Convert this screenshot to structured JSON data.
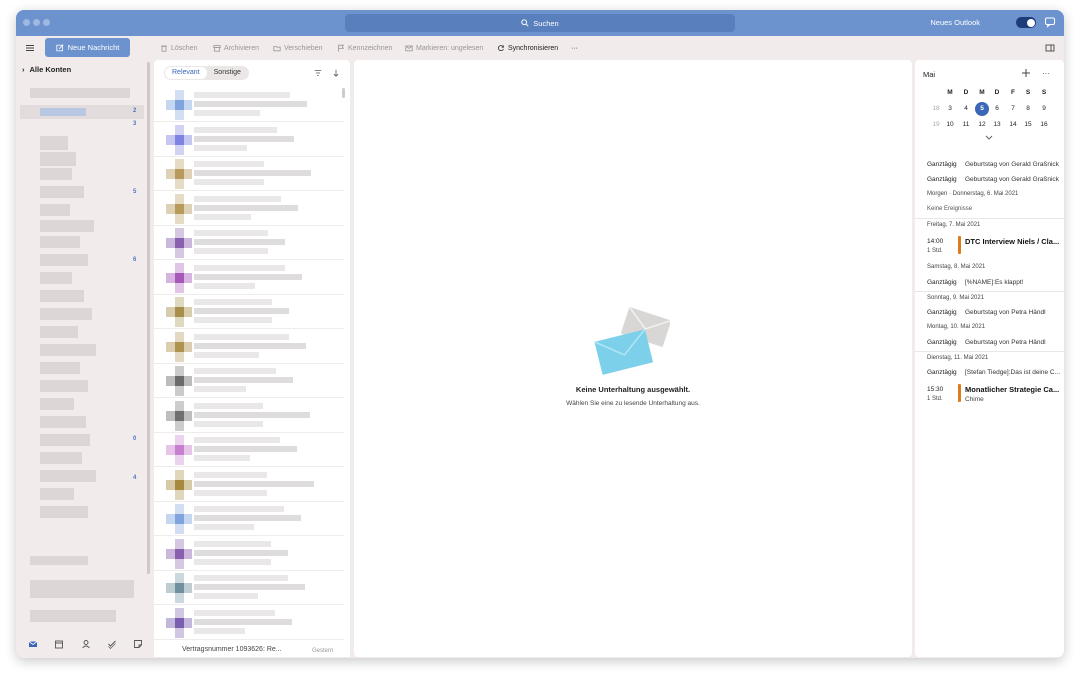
{
  "titlebar": {
    "search_label": "Suchen",
    "new_outlook_label": "Neues Outlook"
  },
  "toolbar": {
    "new_message_label": "Neue Nachricht",
    "items": [
      {
        "label": "Löschen"
      },
      {
        "label": "Archivieren"
      },
      {
        "label": "Verschieben"
      },
      {
        "label": "Kennzeichnen"
      },
      {
        "label": "Markieren: ungelesen"
      },
      {
        "label": "Synchronisieren"
      }
    ],
    "more_label": "···"
  },
  "sidebar": {
    "all_accounts_label": "Alle Konten",
    "badges": [
      "2",
      "3",
      "5",
      "6",
      "0",
      "4"
    ]
  },
  "list": {
    "tabs": [
      {
        "label": "Relevant"
      },
      {
        "label": "Sonstige"
      }
    ],
    "last_row_text": "Vertragsnummer 1093626: Re...",
    "last_row_meta": "Gestern"
  },
  "reading": {
    "empty_title": "Keine Unterhaltung ausgewählt.",
    "empty_subtitle": "Wählen Sie eine zu lesende Unterhaltung aus."
  },
  "calendar": {
    "month": "Mai",
    "more_label": "···",
    "weekdays": [
      "M",
      "D",
      "M",
      "D",
      "F",
      "S",
      "S"
    ],
    "weeks": [
      {
        "num": "18",
        "days": [
          "3",
          "4",
          "5",
          "6",
          "7",
          "8",
          "9"
        ]
      },
      {
        "num": "19",
        "days": [
          "10",
          "11",
          "12",
          "13",
          "14",
          "15",
          "16"
        ]
      }
    ],
    "today": "5",
    "allday_label": "Ganztägig",
    "today_events": [
      "Geburtstag von Gerald Graßnick",
      "Geburtstag von Gerald Graßnick"
    ],
    "tomorrow_header": "Morgen · Donnerstag, 6. Mai 2021",
    "no_events": "Keine Ereignisse",
    "friday_header": "Freitag, 7. Mai 2021",
    "friday_event": {
      "time": "14:00",
      "duration": "1 Std.",
      "title": "DTC Interview Niels / Cla..."
    },
    "saturday_header": "Samstag, 8. Mai 2021",
    "saturday_event": "[%NAME]:Es klappt!",
    "sunday_header": "Sonntag, 9. Mai 2021",
    "sunday_event": "Geburtstag von Petra Händl",
    "monday_header": "Montag, 10. Mai 2021",
    "monday_event": "Geburtstag von Petra Händl",
    "tuesday_header": "Dienstag, 11. Mai 2021",
    "tuesday_allday": "[Stefan Tiedge]:Das ist deine C...",
    "tuesday_event": {
      "time": "15:30",
      "duration": "1 Std.",
      "title": "Monatlicher Strategie Ca...",
      "location": "Chime"
    }
  },
  "colors": {
    "accent": "#6d93cf",
    "event_bar": "#e07a1f",
    "today": "#3a67b8"
  }
}
